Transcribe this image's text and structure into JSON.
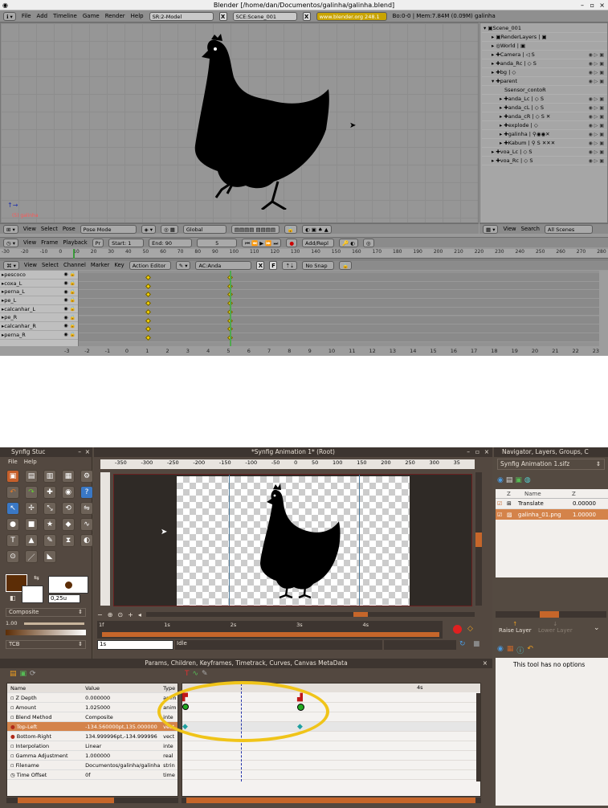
{
  "blender": {
    "title": "Blender [/home/dan/Documentos/galinha/galinha.blend]",
    "menu": [
      "File",
      "Add",
      "Timeline",
      "Game",
      "Render",
      "Help"
    ],
    "screen_field": "SR:2-Model",
    "scene_field": "SCE:Scene_001",
    "website": "www.blender.org 248.1",
    "stats": "Bo:0-0  | Mem:7.84M (0.09M) galinha",
    "view3d_label": "(5) galinha",
    "view3d_header": {
      "menus": [
        "View",
        "Select",
        "Pose"
      ],
      "mode": "Pose Mode",
      "orientation": "Global"
    },
    "outliner": {
      "rows": [
        "Scene_001",
        "RenderLayers",
        "World",
        "Camera",
        "anda_Rc",
        "bg",
        "parent",
        "sensor_contoR",
        "anda_Lc",
        "anda_cL",
        "anda_cR",
        "explode",
        "galinha",
        "Kabum",
        "voa_Lc",
        "voa_Rc"
      ],
      "header": {
        "menus": [
          "View",
          "Search"
        ],
        "dropdown": "All Scenes"
      }
    },
    "timeline_header": {
      "menus": [
        "View",
        "Frame",
        "Playback"
      ],
      "start": "Start: 1",
      "end": "End: 90",
      "current": "5",
      "keying": "Add/Repl"
    },
    "ruler_ticks": [
      "-30",
      "-20",
      "-10",
      "0",
      "10",
      "20",
      "30",
      "40",
      "50",
      "60",
      "70",
      "80",
      "90",
      "100",
      "110",
      "120",
      "130",
      "140",
      "150",
      "160",
      "170",
      "180",
      "190",
      "200",
      "210",
      "220",
      "230",
      "240",
      "250",
      "260",
      "270",
      "280"
    ],
    "action_header": {
      "menus": [
        "View",
        "Select",
        "Channel",
        "Marker",
        "Key"
      ],
      "editor": "Action Editor",
      "action": "AC:Anda",
      "snap": "No Snap"
    },
    "channels": [
      "pescoco",
      "coxa_L",
      "perna_L",
      "pe_L",
      "calcanhar_L",
      "pe_R",
      "calcanhar_R",
      "perna_R"
    ],
    "action_numbers": [
      "-3",
      "-2",
      "-1",
      "0",
      "1",
      "2",
      "3",
      "4",
      "5",
      "6",
      "7",
      "8",
      "9",
      "10",
      "11",
      "12",
      "13",
      "14",
      "15",
      "16",
      "17",
      "18",
      "19",
      "20",
      "21",
      "22",
      "23"
    ]
  },
  "synfig": {
    "toolbox_title": "Synfig Stuc",
    "toolbox_menu": [
      "File",
      "Help"
    ],
    "brush_size": "0,25u",
    "blend": "Composite",
    "opacity": "1.00",
    "bline_label": "TCB",
    "canvas_title": "*Synfig Animation 1* (Root)",
    "h_ruler": [
      "-350",
      "-300",
      "-250",
      "-200",
      "-150",
      "-100",
      "-50",
      "0",
      "50",
      "100",
      "150",
      "200",
      "250",
      "300",
      "35"
    ],
    "time_field": "1s",
    "status": "Idle",
    "time_marks": [
      "1f",
      "1s",
      "2s",
      "3s",
      "4s"
    ],
    "right_title": "Navigator, Layers, Groups, C",
    "file_dropdown": "Synfig Animation 1.sifz",
    "layers_header": [
      "Z",
      "Name",
      "Z"
    ],
    "layers": [
      {
        "name": "Translate",
        "z": "0.00000"
      },
      {
        "name": "galinha_01.png",
        "z": "1.00000"
      }
    ],
    "raise_layer": "Raise Layer",
    "lower_layer": "Lower Layer",
    "tool_options": "This tool has no options",
    "params_title": "Params, Children, Keyframes, Timetrack, Curves, Canvas MetaData",
    "params_headers": [
      "Name",
      "Value",
      "Type"
    ],
    "params": [
      {
        "name": "Z Depth",
        "value": "0.000000",
        "type": "anim"
      },
      {
        "name": "Amount",
        "value": "1.025000",
        "type": "anim"
      },
      {
        "name": "Blend Method",
        "value": "Composite",
        "type": "inte"
      },
      {
        "name": "Top-Left",
        "value": "-134.560000pt,135.000000",
        "type": "vect"
      },
      {
        "name": "Bottom-Right",
        "value": "134.999996pt,-134.999996",
        "type": "vect"
      },
      {
        "name": "Interpolation",
        "value": "Linear",
        "type": "inte"
      },
      {
        "name": "Gamma Adjustment",
        "value": "1.000000",
        "type": "real"
      },
      {
        "name": "Filename",
        "value": "Documentos/galinha/galinha",
        "type": "strin"
      },
      {
        "name": "Time Offset",
        "value": "0f",
        "type": "time"
      }
    ],
    "timetrack_label": "4s",
    "colors": {
      "outline": "#5c2d06",
      "fill": "#ffffff",
      "highlight": "#f0c419"
    }
  }
}
